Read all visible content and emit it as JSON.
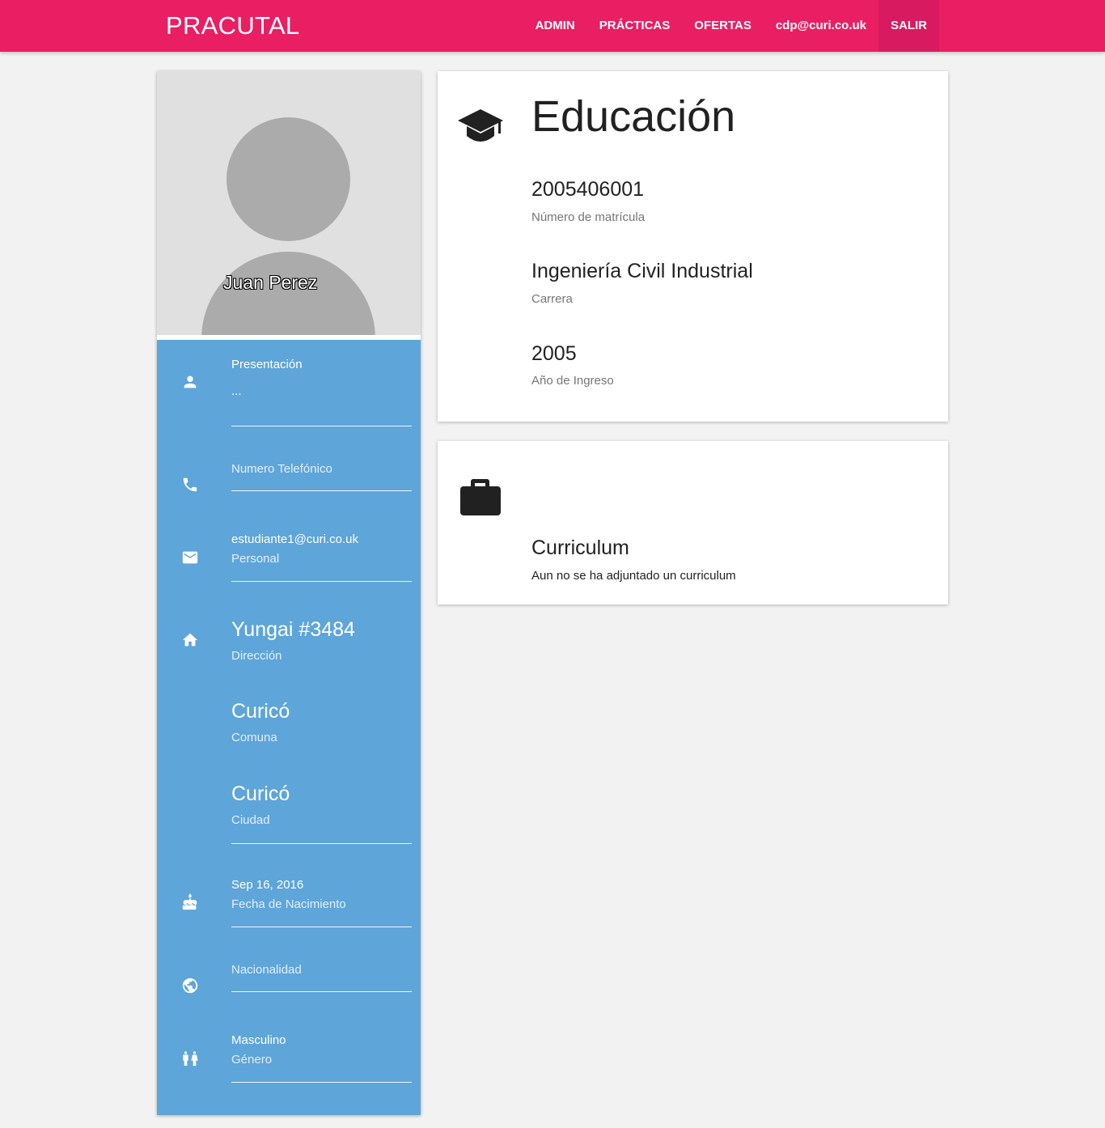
{
  "navbar": {
    "brand": "PRACUTAL",
    "items": [
      {
        "label": "ADMIN"
      },
      {
        "label": "PRÁCTICAS"
      },
      {
        "label": "OFERTAS"
      },
      {
        "label": "cdp@curi.co.uk"
      },
      {
        "label": "SALIR"
      }
    ]
  },
  "profile": {
    "name": "Juan Perez",
    "presentation": {
      "label": "Presentación",
      "value": "..."
    },
    "phone": {
      "label": "Numero Telefónico",
      "value": ""
    },
    "email": {
      "value": "estudiante1@curi.co.uk",
      "label": "Personal"
    },
    "address": {
      "value": "Yungai #3484",
      "label": "Dirección"
    },
    "comuna": {
      "value": "Curicó",
      "label": "Comuna"
    },
    "city": {
      "value": "Curicó",
      "label": "Ciudad"
    },
    "birthdate": {
      "value": "Sep 16, 2016",
      "label": "Fecha de Nacimiento"
    },
    "nationality": {
      "label": "Nacionalidad",
      "value": ""
    },
    "gender": {
      "value": "Masculino",
      "label": "Género"
    }
  },
  "education": {
    "title": "Educación",
    "enrollment": {
      "value": "2005406001",
      "label": "Número de matrícula"
    },
    "career": {
      "value": "Ingeniería Civil Industrial",
      "label": "Carrera"
    },
    "year": {
      "value": "2005",
      "label": "Año de Ingreso"
    }
  },
  "curriculum": {
    "title": "Curriculum",
    "status": "Aun no se ha adjuntado un curriculum"
  },
  "colors": {
    "primary": "#e91e63",
    "primary_dark": "#d81b60",
    "sidebar": "#5ea5d9",
    "background": "#f2f2f2"
  }
}
